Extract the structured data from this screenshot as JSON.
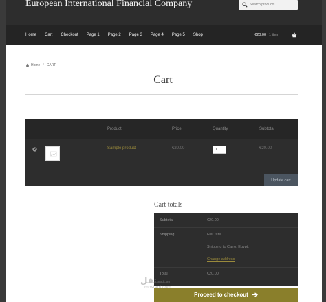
{
  "site": {
    "title": "European International Financial Company",
    "search_placeholder": "Search products..."
  },
  "nav": {
    "items": [
      "Home",
      "Cart",
      "Checkout",
      "Page 1",
      "Page 2",
      "Page 3",
      "Page 4",
      "Page 5",
      "Shop"
    ],
    "cart_total": "€20.00",
    "cart_count": "1 item"
  },
  "breadcrumb": {
    "home": "Home",
    "current": "CART"
  },
  "page": {
    "title": "Cart"
  },
  "cart_table": {
    "headers": {
      "product": "Product",
      "price": "Price",
      "quantity": "Quantity",
      "subtotal": "Subtotal"
    },
    "row": {
      "product": "Sample product",
      "price": "€20.00",
      "quantity": "1",
      "subtotal": "€20.00"
    },
    "update_label": "Update cart"
  },
  "totals": {
    "title": "Cart totals",
    "subtotal_label": "Subtotal",
    "subtotal_value": "€20.00",
    "shipping_label": "Shipping",
    "shipping_method": "Flat rate",
    "shipping_to": "Shipping to Cairo, Egypt.",
    "change_address": "Change address",
    "total_label": "Total",
    "total_value": "€20.00"
  },
  "checkout_label": "Proceed to checkout",
  "watermark": {
    "main": "مستقل",
    "sub": "mostaql.com"
  },
  "colors": {
    "accent": "#8a7f2b",
    "header_bg": "#2d2d2d",
    "nav_bg": "#242424",
    "update_btn": "#4b5560"
  }
}
